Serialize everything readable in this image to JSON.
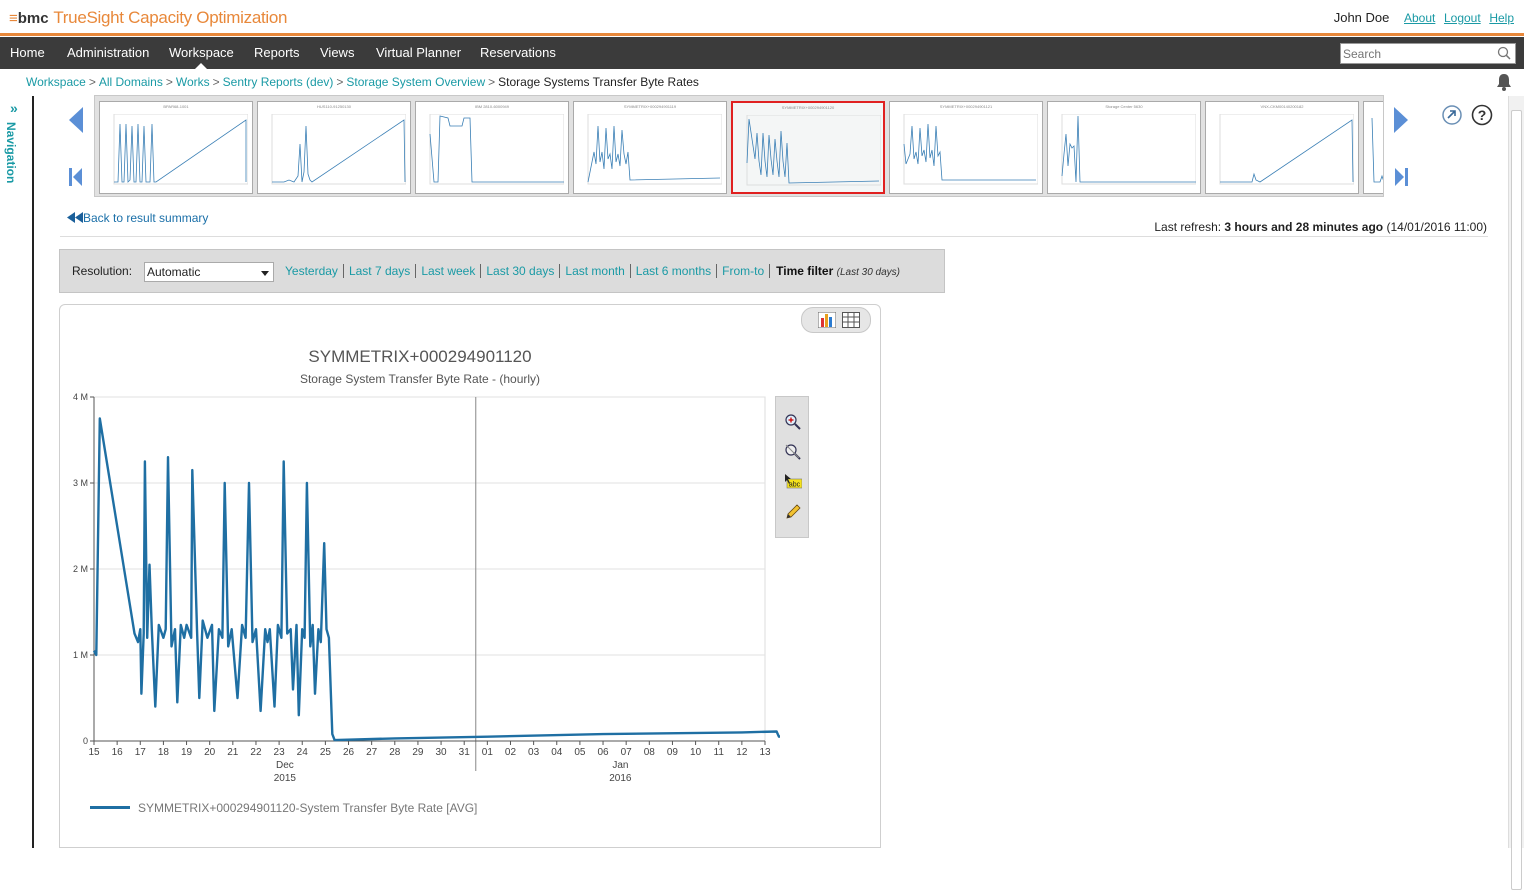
{
  "brand": {
    "company": "bmc",
    "product": "TrueSight Capacity Optimization"
  },
  "user": {
    "name": "John Doe",
    "links": [
      "About",
      "Logout",
      "Help"
    ]
  },
  "menu": {
    "items": [
      "Home",
      "Administration",
      "Workspace",
      "Reports",
      "Views",
      "Virtual Planner",
      "Reservations"
    ],
    "active": "Workspace"
  },
  "search": {
    "placeholder": "Search"
  },
  "breadcrumb": {
    "items": [
      "Workspace",
      "All Domains",
      "Works",
      "Sentry Reports (dev)",
      "Storage System Overview"
    ],
    "current": "Storage Systems Transfer Byte Rates",
    "separator": ">"
  },
  "navigation": {
    "label": "Navigation",
    "toggle": "»"
  },
  "thumbnails": [
    {
      "label": "BPAR68-1001",
      "selected": false
    },
    {
      "label": "HUS110-91250130",
      "selected": false
    },
    {
      "label": "IBM 2810-6000949",
      "selected": false
    },
    {
      "label": "SYMMETRIX+000294901119",
      "selected": false
    },
    {
      "label": "SYMMETRIX+000294901120",
      "selected": true
    },
    {
      "label": "SYMMETRIX+000294901121",
      "selected": false
    },
    {
      "label": "Storage Center 5630",
      "selected": false
    },
    {
      "label": "VNX-CKM00140200182",
      "selected": false
    }
  ],
  "back_link": "Back to result summary",
  "refresh": {
    "label": "Last refresh:",
    "value": "3 hours and 28 minutes ago",
    "timestamp": "(14/01/2016 11:00)"
  },
  "filter": {
    "resolution_label": "Resolution:",
    "resolution_value": "Automatic",
    "periods": [
      "Yesterday",
      "Last 7 days",
      "Last week",
      "Last 30 days",
      "Last month",
      "Last 6 months",
      "From-to"
    ],
    "time_filter": "Time filter",
    "time_filter_sub": "(Last 30 days)"
  },
  "colors": {
    "accent": "#e8883a",
    "link": "#1a9aa5",
    "series": "#1f6fa3",
    "menu_bg": "#3b3b3b"
  },
  "chart_data": {
    "type": "line",
    "title": "SYMMETRIX+000294901120",
    "subtitle": "Storage System Transfer Byte Rate - (hourly)",
    "y_ticks": [
      "0",
      "1 M",
      "2 M",
      "3 M",
      "4 M"
    ],
    "ylim": [
      0,
      4000000
    ],
    "x_ticks": [
      "15",
      "16",
      "17",
      "18",
      "19",
      "20",
      "21",
      "22",
      "23",
      "24",
      "25",
      "26",
      "27",
      "28",
      "29",
      "30",
      "31",
      "01",
      "02",
      "03",
      "04",
      "05",
      "06",
      "07",
      "08",
      "09",
      "10",
      "11",
      "12",
      "13"
    ],
    "x_groups": [
      {
        "month": "Dec",
        "year": "2015"
      },
      {
        "month": "Jan",
        "year": "2016"
      }
    ],
    "grid": true,
    "series": [
      {
        "name": "SYMMETRIX+000294901120-System Transfer Byte Rate [AVG]",
        "points": [
          [
            0,
            1050000
          ],
          [
            0.1,
            1000000
          ],
          [
            0.25,
            3750000
          ],
          [
            1.75,
            1250000
          ],
          [
            1.9,
            1150000
          ],
          [
            2.0,
            1300000
          ],
          [
            2.05,
            550000
          ],
          [
            2.15,
            1250000
          ],
          [
            2.2,
            3250000
          ],
          [
            2.3,
            1200000
          ],
          [
            2.4,
            2050000
          ],
          [
            2.5,
            1300000
          ],
          [
            2.65,
            400000
          ],
          [
            2.8,
            1350000
          ],
          [
            3.0,
            1200000
          ],
          [
            3.1,
            1300000
          ],
          [
            3.2,
            3300000
          ],
          [
            3.35,
            1100000
          ],
          [
            3.5,
            1300000
          ],
          [
            3.6,
            450000
          ],
          [
            3.75,
            1350000
          ],
          [
            3.9,
            1200000
          ],
          [
            4.0,
            1350000
          ],
          [
            4.2,
            1200000
          ],
          [
            4.25,
            3150000
          ],
          [
            4.45,
            1300000
          ],
          [
            4.55,
            500000
          ],
          [
            4.7,
            1400000
          ],
          [
            4.9,
            1200000
          ],
          [
            5.1,
            1350000
          ],
          [
            5.2,
            350000
          ],
          [
            5.4,
            1300000
          ],
          [
            5.55,
            1200000
          ],
          [
            5.65,
            3000000
          ],
          [
            5.8,
            1100000
          ],
          [
            5.95,
            1300000
          ],
          [
            6.2,
            500000
          ],
          [
            6.4,
            1350000
          ],
          [
            6.55,
            1200000
          ],
          [
            6.7,
            3000000
          ],
          [
            6.85,
            1150000
          ],
          [
            7.0,
            1300000
          ],
          [
            7.2,
            350000
          ],
          [
            7.4,
            1300000
          ],
          [
            7.5,
            1150000
          ],
          [
            7.6,
            1300000
          ],
          [
            7.8,
            400000
          ],
          [
            7.95,
            1350000
          ],
          [
            8.1,
            1200000
          ],
          [
            8.2,
            3250000
          ],
          [
            8.35,
            1250000
          ],
          [
            8.5,
            1300000
          ],
          [
            8.6,
            600000
          ],
          [
            8.75,
            1350000
          ],
          [
            8.85,
            300000
          ],
          [
            9.0,
            1300000
          ],
          [
            9.1,
            1200000
          ],
          [
            9.2,
            3000000
          ],
          [
            9.35,
            1100000
          ],
          [
            9.45,
            1350000
          ],
          [
            9.55,
            550000
          ],
          [
            9.7,
            1300000
          ],
          [
            9.8,
            1150000
          ],
          [
            9.95,
            2300000
          ],
          [
            10.05,
            1300000
          ],
          [
            10.15,
            1200000
          ],
          [
            10.3,
            80000
          ],
          [
            10.4,
            10000
          ],
          [
            13.0,
            30000
          ],
          [
            17.0,
            50000
          ],
          [
            22.0,
            80000
          ],
          [
            28.0,
            100000
          ],
          [
            29.5,
            110000
          ],
          [
            29.6,
            50000
          ],
          [
            29.8,
            60000
          ],
          [
            30.1,
            50000
          ]
        ]
      }
    ]
  }
}
